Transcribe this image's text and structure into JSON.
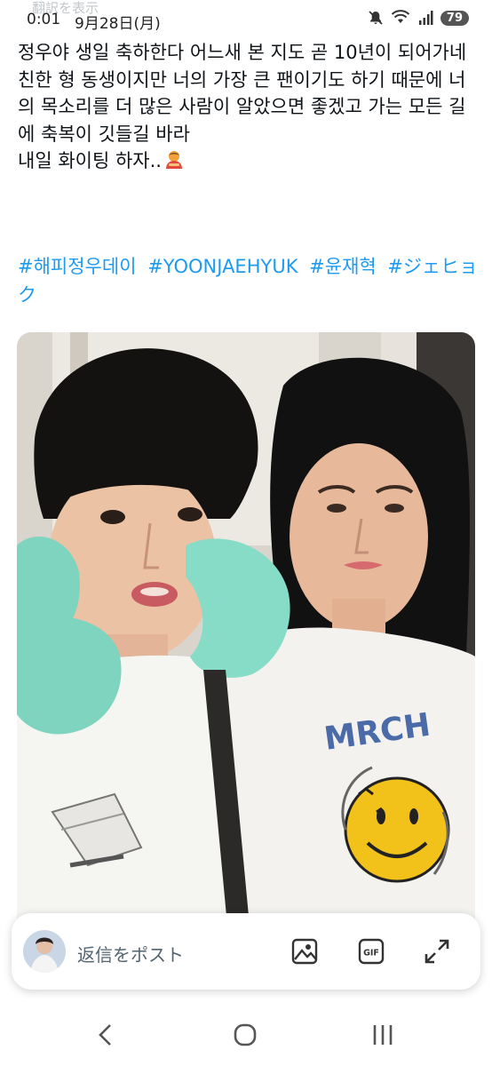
{
  "status_bar": {
    "time": "0:01",
    "date": "9月28日(月)",
    "battery": "79",
    "translate_label": "翻訳を表示"
  },
  "tweet": {
    "text": "정우야 생일 축하한다 어느새 본 지도 곧 10년이 되어가네\n친한 형 동생이지만 너의 가장 큰 팬이기도 하기 때문에 너의 목소리를 더 많은 사람이 알았으면 좋겠고 가는 모든 길에 축복이 깃들길 바라\n내일 화이팅 하자..",
    "hashtags": [
      "#해피정우데이",
      "#YOONJAEHYUK",
      "#윤재혁",
      "#ジェヒョク"
    ],
    "emoji": "person-bowing-emoji"
  },
  "photo": {
    "shirt_print": "MRCH"
  },
  "reply_bar": {
    "placeholder": "返信をポスト",
    "gif_label": "GIF"
  },
  "colors": {
    "accent": "#1d9bf0",
    "text": "#0f1419",
    "muted": "#536471"
  }
}
